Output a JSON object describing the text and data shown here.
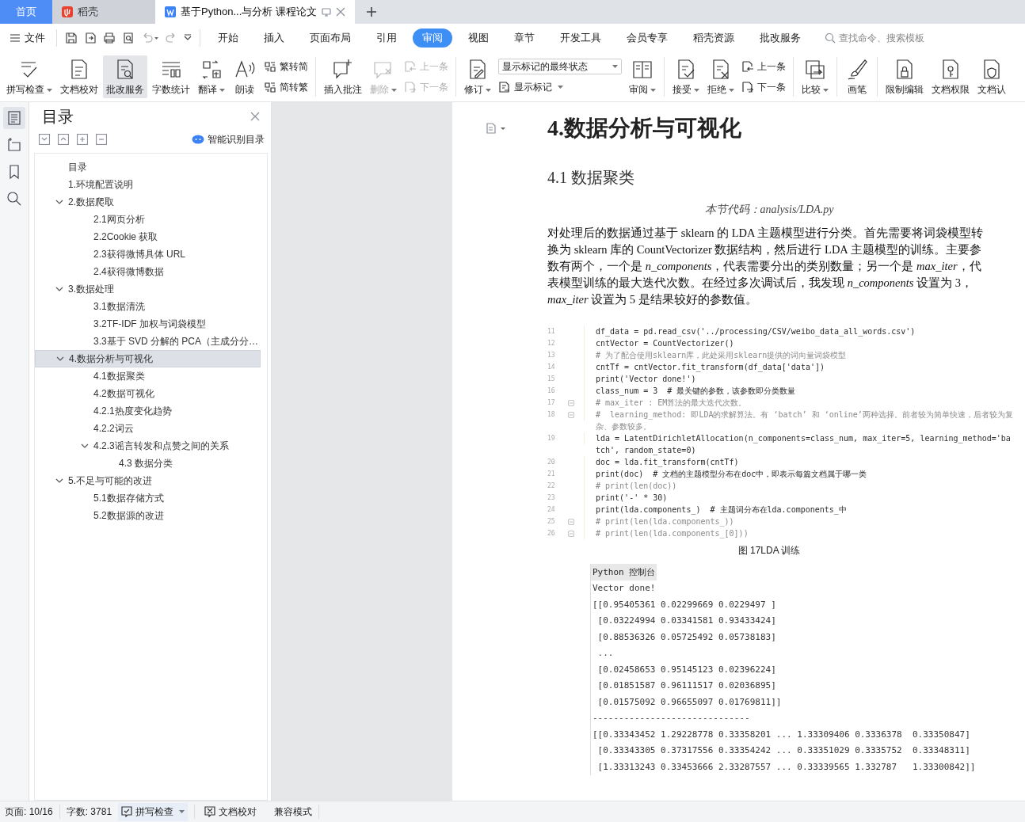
{
  "tabs": [
    {
      "label": "首页",
      "kind": "home",
      "selected": false
    },
    {
      "label": "稻壳",
      "kind": "app",
      "selected": false
    },
    {
      "label": "基于Python...与分析 课程论文",
      "kind": "doc",
      "selected": true
    }
  ],
  "menu": {
    "file": "文件",
    "items": [
      {
        "label": "开始",
        "selected": false
      },
      {
        "label": "插入",
        "selected": false
      },
      {
        "label": "页面布局",
        "selected": false
      },
      {
        "label": "引用",
        "selected": false
      },
      {
        "label": "审阅",
        "selected": true
      },
      {
        "label": "视图",
        "selected": false
      },
      {
        "label": "章节",
        "selected": false
      },
      {
        "label": "开发工具",
        "selected": false
      },
      {
        "label": "会员专享",
        "selected": false
      },
      {
        "label": "稻壳资源",
        "selected": false
      },
      {
        "label": "批改服务",
        "selected": false
      }
    ],
    "search": {
      "placeholder": "查找命令、搜索模板"
    }
  },
  "ribbon": [
    {
      "kind": "big",
      "label": "拼写检查",
      "dropdown": true,
      "disabled": false,
      "active": false
    },
    {
      "kind": "big",
      "label": "文档校对",
      "dropdown": false,
      "disabled": false,
      "active": false
    },
    {
      "kind": "big",
      "label": "批改服务",
      "dropdown": false,
      "disabled": false,
      "active": true
    },
    {
      "kind": "big",
      "label": "字数统计",
      "dropdown": false,
      "disabled": false,
      "active": false
    },
    {
      "kind": "big",
      "label": "翻译",
      "dropdown": true,
      "disabled": false,
      "active": false
    },
    {
      "kind": "big",
      "label": "朗读",
      "dropdown": false,
      "disabled": false,
      "active": false
    },
    {
      "kind": "pair",
      "items": [
        {
          "label": "繁转简",
          "disabled": false
        },
        {
          "label": "简转繁",
          "disabled": false
        }
      ]
    },
    {
      "kind": "separator"
    },
    {
      "kind": "big",
      "label": "插入批注",
      "dropdown": false,
      "disabled": false,
      "active": false
    },
    {
      "kind": "big",
      "label": "删除",
      "dropdown": true,
      "disabled": true,
      "active": false
    },
    {
      "kind": "pair",
      "items": [
        {
          "label": "上一条",
          "disabled": true
        },
        {
          "label": "下一条",
          "disabled": true
        }
      ]
    },
    {
      "kind": "separator"
    },
    {
      "kind": "big",
      "label": "修订",
      "dropdown": true,
      "disabled": false,
      "active": false
    },
    {
      "kind": "markup",
      "value": "显示标记的最终状态",
      "label": "显示标记"
    },
    {
      "kind": "big",
      "label": "审阅",
      "dropdown": true,
      "disabled": false,
      "active": false
    },
    {
      "kind": "separator"
    },
    {
      "kind": "big",
      "label": "接受",
      "dropdown": true,
      "disabled": false,
      "active": false
    },
    {
      "kind": "big",
      "label": "拒绝",
      "dropdown": true,
      "disabled": false,
      "active": false
    },
    {
      "kind": "pair",
      "items": [
        {
          "label": "上一条",
          "disabled": false
        },
        {
          "label": "下一条",
          "disabled": false
        }
      ]
    },
    {
      "kind": "separator"
    },
    {
      "kind": "big",
      "label": "比较",
      "dropdown": true,
      "disabled": false,
      "active": false
    },
    {
      "kind": "separator"
    },
    {
      "kind": "big",
      "label": "画笔",
      "dropdown": false,
      "disabled": false,
      "active": false
    },
    {
      "kind": "separator"
    },
    {
      "kind": "big",
      "label": "限制编辑",
      "dropdown": false,
      "disabled": false,
      "active": false
    },
    {
      "kind": "big",
      "label": "文档权限",
      "dropdown": false,
      "disabled": false,
      "active": false
    },
    {
      "kind": "big",
      "label": "文档认",
      "dropdown": false,
      "disabled": false,
      "active": false
    }
  ],
  "nav": {
    "title": "目录",
    "smart": "智能识别目录",
    "items": [
      {
        "label": "目录",
        "selected": false
      },
      {
        "label": "1.环境配置说明",
        "selected": false
      },
      {
        "label": "2.数据爬取",
        "selected": false,
        "expanded": true,
        "children": [
          {
            "label": "2.1网页分析",
            "selected": false
          },
          {
            "label": "2.2Cookie 获取",
            "selected": false
          },
          {
            "label": "2.3获得微博具体 URL",
            "selected": false
          },
          {
            "label": "2.4获得微博数据",
            "selected": false
          }
        ]
      },
      {
        "label": "3.数据处理",
        "selected": false,
        "expanded": true,
        "children": [
          {
            "label": "3.1数据清洗",
            "selected": false
          },
          {
            "label": "3.2TF-IDF 加权与词袋模型",
            "selected": false
          },
          {
            "label": "3.3基于 SVD 分解的 PCA（主成分分…",
            "selected": false
          }
        ]
      },
      {
        "label": "4.数据分析与可视化",
        "selected": true,
        "expanded": true,
        "children": [
          {
            "label": "4.1数据聚类",
            "selected": false
          },
          {
            "label": "4.2数据可视化",
            "selected": false
          },
          {
            "label": "4.2.1热度变化趋势",
            "selected": false
          },
          {
            "label": "4.2.2词云",
            "selected": false
          },
          {
            "label": "4.2.3谣言转发和点赞之间的关系",
            "selected": false,
            "expanded": true,
            "children": [
              {
                "label": "4.3 数据分类",
                "selected": false
              }
            ]
          }
        ]
      },
      {
        "label": "5.不足与可能的改进",
        "selected": false,
        "expanded": true,
        "children": [
          {
            "label": "5.1数据存储方式",
            "selected": false
          },
          {
            "label": "5.2数据源的改进",
            "selected": false
          }
        ]
      }
    ]
  },
  "document": {
    "heading": "4.数据分析与可视化",
    "subheading": "4.1  数据聚类",
    "code_note": "本节代码：analysis/LDA.py",
    "paragraph": "对处理后的数据通过基于 sklearn 的 LDA 主题模型进行分类。首先需要将词袋模型转换为 sklearn 库的 CountVectorizer 数据结构，然后进行 LDA 主题模型的训练。主要参数有两个，一个是 *n_components*，代表需要分出的类别数量；另一个是 *max_iter*，代表模型训练的最大迭代次数。在经过多次调试后，我发现 *n_components* 设置为 3，*max_iter* 设置为 5 是结果较好的参数值。",
    "code": [
      {
        "number": "11",
        "text": "df_data = pd.read_csv('../processing/CSV/weibo_data_all_words.csv')",
        "kind": "code",
        "fold": false
      },
      {
        "number": "12",
        "text": "cntVector = CountVectorizer()",
        "kind": "code",
        "fold": false
      },
      {
        "number": "13",
        "text": "# 为了配合使用sklearn库，此处采用sklearn提供的词向量词袋模型",
        "kind": "comment",
        "fold": false
      },
      {
        "number": "14",
        "text": "cntTf = cntVector.fit_transform(df_data['data'])",
        "kind": "code",
        "fold": false
      },
      {
        "number": "15",
        "text": "print('Vector done!')",
        "kind": "code",
        "fold": false
      },
      {
        "number": "16",
        "text": "class_num = 3  # 最关键的参数，该参数即分类数量",
        "kind": "code",
        "fold": false
      },
      {
        "number": "17",
        "text": "# max_iter : EM算法的最大迭代次数。",
        "kind": "comment",
        "fold": true
      },
      {
        "number": "18",
        "text": "#  learning_method: 即LDA的求解算法。有 ‘batch’ 和 ‘online’两种选择。前者较为简单快速，后者较为复杂、参数较多。",
        "kind": "comment",
        "fold": true
      },
      {
        "number": "19",
        "text": "lda = LatentDirichletAllocation(n_components=class_num, max_iter=5, learning_method='batch', random_state=0)",
        "kind": "code",
        "fold": false
      },
      {
        "number": "20",
        "text": "doc = lda.fit_transform(cntTf)",
        "kind": "code",
        "fold": false
      },
      {
        "number": "21",
        "text": "print(doc)  # 文档的主题模型分布在doc中，即表示每篇文档属于哪一类",
        "kind": "code",
        "fold": false
      },
      {
        "number": "22",
        "text": "# print(len(doc))",
        "kind": "comment",
        "fold": false
      },
      {
        "number": "23",
        "text": "print('-' * 30)",
        "kind": "code",
        "fold": false
      },
      {
        "number": "24",
        "text": "print(lda.components_)  # 主题词分布在lda.components_中",
        "kind": "code",
        "fold": false
      },
      {
        "number": "25",
        "text": "# print(len(lda.components_))",
        "kind": "comment",
        "fold": true
      },
      {
        "number": "26",
        "text": "# print(len(lda.components_[0]))",
        "kind": "comment",
        "fold": true
      }
    ],
    "caption": "图  17LDA 训练",
    "console": {
      "title": "Python 控制台",
      "lines": [
        "Vector done!",
        "[[0.95405361 0.02299669 0.0229497 ]",
        " [0.03224994 0.03341581 0.93433424]",
        " [0.88536326 0.05725492 0.05738183]",
        " ...",
        " [0.02458653 0.95145123 0.02396224]",
        " [0.01851587 0.96111517 0.02036895]",
        " [0.01575092 0.96655097 0.01769811]]",
        "------------------------------",
        "[[0.33343452 1.29228778 0.33358201 ... 1.33309406 0.3336378  0.33350847]",
        " [0.33343305 0.37317556 0.33354242 ... 0.33351029 0.3335752  0.33348311]",
        " [1.33313243 0.33453666 2.33287557 ... 0.33339565 1.332787   1.33300842]]"
      ]
    }
  },
  "status_bar": {
    "page": "页面: 10/16",
    "words": "字数: 3781",
    "spell": "拼写检查",
    "proof": "文档校对",
    "mode": "兼容模式"
  }
}
